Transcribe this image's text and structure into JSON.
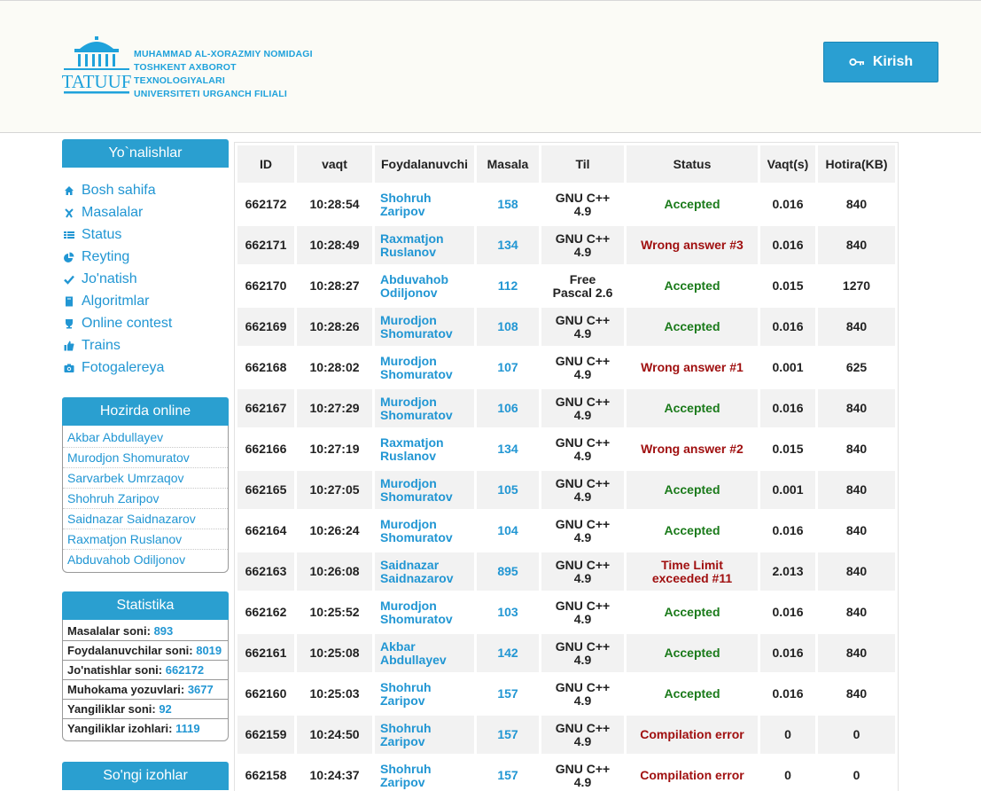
{
  "header": {
    "logo_emblem_text": "TATUUF",
    "logo_lines": [
      "MUHAMMAD AL-XORAZMIY NOMIDAGI",
      "TOSHKENT AXBOROT TEXNOLOGIYALARI",
      "UNIVERSITETI URGANCH FILIALI"
    ],
    "login_label": "Kirish"
  },
  "sidebar": {
    "nav_title": "Yo`nalishlar",
    "nav_items": [
      {
        "label": "Bosh sahifa",
        "icon": "home-icon"
      },
      {
        "label": "Masalalar",
        "icon": "puzzle-icon"
      },
      {
        "label": "Status",
        "icon": "list-icon"
      },
      {
        "label": "Reyting",
        "icon": "pie-chart-icon"
      },
      {
        "label": "Jo'natish",
        "icon": "check-icon"
      },
      {
        "label": "Algoritmlar",
        "icon": "book-icon"
      },
      {
        "label": "Online contest",
        "icon": "cup-icon"
      },
      {
        "label": "Trains",
        "icon": "thumb-icon"
      },
      {
        "label": "Fotogalereya",
        "icon": "camera-icon"
      }
    ],
    "online_title": "Hozirda online",
    "online_users": [
      "Akbar Abdullayev",
      "Murodjon Shomuratov",
      "Sarvarbek Umrzaqov",
      "Shohruh Zaripov",
      "Saidnazar Saidnazarov",
      "Raxmatjon Ruslanov",
      "Abduvahob Odiljonov"
    ],
    "stats_title": "Statistika",
    "stats": [
      {
        "label": "Masalalar soni:",
        "value": "893"
      },
      {
        "label": "Foydalanuvchilar soni:",
        "value": "8019"
      },
      {
        "label": "Jo'natishlar soni:",
        "value": "662172"
      },
      {
        "label": "Muhokama yozuvlari:",
        "value": "3677"
      },
      {
        "label": "Yangiliklar soni:",
        "value": "92"
      },
      {
        "label": "Yangiliklar izohlari:",
        "value": "1119"
      }
    ],
    "comments_title": "So'ngi izohlar"
  },
  "table": {
    "columns": [
      "ID",
      "vaqt",
      "Foydalanuvchi",
      "Masala",
      "Til",
      "Status",
      "Vaqt(s)",
      "Hotira(KB)"
    ],
    "rows": [
      {
        "id": "662172",
        "time": "10:28:54",
        "user": [
          "Shohruh",
          "Zaripov"
        ],
        "problem": "158",
        "lang": [
          "GNU C++",
          "4.9"
        ],
        "status": [
          "Accepted"
        ],
        "ok": true,
        "cpu": "0.016",
        "mem": "840"
      },
      {
        "id": "662171",
        "time": "10:28:49",
        "user": [
          "Raxmatjon",
          "Ruslanov"
        ],
        "problem": "134",
        "lang": [
          "GNU C++",
          "4.9"
        ],
        "status": [
          "Wrong answer #3"
        ],
        "ok": false,
        "cpu": "0.016",
        "mem": "840"
      },
      {
        "id": "662170",
        "time": "10:28:27",
        "user": [
          "Abduvahob",
          "Odiljonov"
        ],
        "problem": "112",
        "lang": [
          "Free",
          "Pascal 2.6"
        ],
        "status": [
          "Accepted"
        ],
        "ok": true,
        "cpu": "0.015",
        "mem": "1270"
      },
      {
        "id": "662169",
        "time": "10:28:26",
        "user": [
          "Murodjon",
          "Shomuratov"
        ],
        "problem": "108",
        "lang": [
          "GNU C++",
          "4.9"
        ],
        "status": [
          "Accepted"
        ],
        "ok": true,
        "cpu": "0.016",
        "mem": "840"
      },
      {
        "id": "662168",
        "time": "10:28:02",
        "user": [
          "Murodjon",
          "Shomuratov"
        ],
        "problem": "107",
        "lang": [
          "GNU C++",
          "4.9"
        ],
        "status": [
          "Wrong answer #1"
        ],
        "ok": false,
        "cpu": "0.001",
        "mem": "625"
      },
      {
        "id": "662167",
        "time": "10:27:29",
        "user": [
          "Murodjon",
          "Shomuratov"
        ],
        "problem": "106",
        "lang": [
          "GNU C++",
          "4.9"
        ],
        "status": [
          "Accepted"
        ],
        "ok": true,
        "cpu": "0.016",
        "mem": "840"
      },
      {
        "id": "662166",
        "time": "10:27:19",
        "user": [
          "Raxmatjon",
          "Ruslanov"
        ],
        "problem": "134",
        "lang": [
          "GNU C++",
          "4.9"
        ],
        "status": [
          "Wrong answer #2"
        ],
        "ok": false,
        "cpu": "0.015",
        "mem": "840"
      },
      {
        "id": "662165",
        "time": "10:27:05",
        "user": [
          "Murodjon",
          "Shomuratov"
        ],
        "problem": "105",
        "lang": [
          "GNU C++",
          "4.9"
        ],
        "status": [
          "Accepted"
        ],
        "ok": true,
        "cpu": "0.001",
        "mem": "840"
      },
      {
        "id": "662164",
        "time": "10:26:24",
        "user": [
          "Murodjon",
          "Shomuratov"
        ],
        "problem": "104",
        "lang": [
          "GNU C++",
          "4.9"
        ],
        "status": [
          "Accepted"
        ],
        "ok": true,
        "cpu": "0.016",
        "mem": "840"
      },
      {
        "id": "662163",
        "time": "10:26:08",
        "user": [
          "Saidnazar",
          "Saidnazarov"
        ],
        "problem": "895",
        "lang": [
          "GNU C++",
          "4.9"
        ],
        "status": [
          "Time Limit",
          "exceeded #11"
        ],
        "ok": false,
        "cpu": "2.013",
        "mem": "840"
      },
      {
        "id": "662162",
        "time": "10:25:52",
        "user": [
          "Murodjon",
          "Shomuratov"
        ],
        "problem": "103",
        "lang": [
          "GNU C++",
          "4.9"
        ],
        "status": [
          "Accepted"
        ],
        "ok": true,
        "cpu": "0.016",
        "mem": "840"
      },
      {
        "id": "662161",
        "time": "10:25:08",
        "user": [
          "Akbar",
          "Abdullayev"
        ],
        "problem": "142",
        "lang": [
          "GNU C++",
          "4.9"
        ],
        "status": [
          "Accepted"
        ],
        "ok": true,
        "cpu": "0.016",
        "mem": "840"
      },
      {
        "id": "662160",
        "time": "10:25:03",
        "user": [
          "Shohruh",
          "Zaripov"
        ],
        "problem": "157",
        "lang": [
          "GNU C++",
          "4.9"
        ],
        "status": [
          "Accepted"
        ],
        "ok": true,
        "cpu": "0.016",
        "mem": "840"
      },
      {
        "id": "662159",
        "time": "10:24:50",
        "user": [
          "Shohruh",
          "Zaripov"
        ],
        "problem": "157",
        "lang": [
          "GNU C++",
          "4.9"
        ],
        "status": [
          "Compilation error"
        ],
        "ok": false,
        "cpu": "0",
        "mem": "0"
      },
      {
        "id": "662158",
        "time": "10:24:37",
        "user": [
          "Shohruh",
          "Zaripov"
        ],
        "problem": "157",
        "lang": [
          "GNU C++",
          "4.9"
        ],
        "status": [
          "Compilation error"
        ],
        "ok": false,
        "cpu": "0",
        "mem": "0"
      }
    ]
  },
  "colors": {
    "accent": "#2a9fd0",
    "link": "#2196d3",
    "accepted": "#1a7a1a",
    "rejected": "#a01010",
    "row_alt": "#f2f2f2"
  }
}
